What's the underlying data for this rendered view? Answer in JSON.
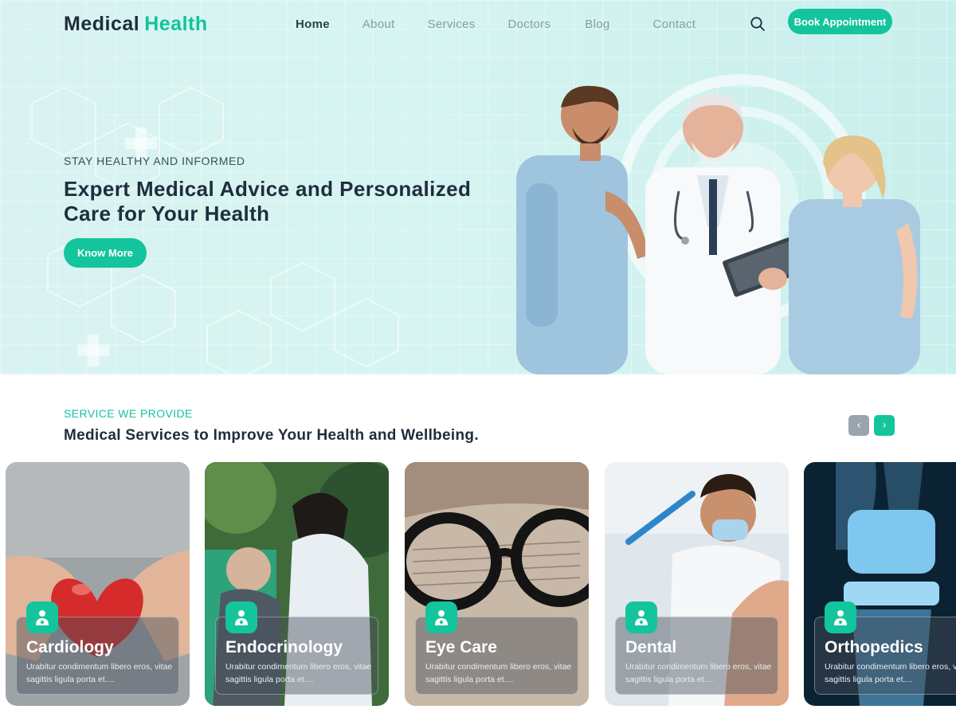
{
  "brand": {
    "word1": "Medical",
    "word2": "Health"
  },
  "nav": {
    "items": [
      {
        "label": "Home",
        "active": true
      },
      {
        "label": "About",
        "active": false
      },
      {
        "label": "Services",
        "active": false
      },
      {
        "label": "Doctors",
        "active": false
      },
      {
        "label": "Blog",
        "active": false
      },
      {
        "label": "Contact",
        "active": false
      }
    ],
    "search_icon": "search-icon",
    "cta": "Book Appointment"
  },
  "hero": {
    "eyebrow": "STAY HEALTHY AND INFORMED",
    "headline": "Expert Medical Advice and Personalized Care for Your Health",
    "button": "Know More"
  },
  "services": {
    "eyebrow": "SERVICE WE PROVIDE",
    "title": "Medical Services to Improve Your Health and Wellbeing.",
    "prev_icon": "chevron-left-icon",
    "next_icon": "chevron-right-icon",
    "cards": [
      {
        "name": "Cardiology",
        "desc": "Urabitur condimentum libero eros, vitae sagittis ligula porta et....",
        "icon": "doctor-icon"
      },
      {
        "name": "Endocrinology",
        "desc": "Urabitur condimentum libero eros, vitae sagittis ligula porta et....",
        "icon": "doctor-icon"
      },
      {
        "name": "Eye Care",
        "desc": "Urabitur condimentum libero eros, vitae sagittis ligula porta et....",
        "icon": "doctor-icon"
      },
      {
        "name": "Dental",
        "desc": "Urabitur condimentum libero eros, vitae sagittis ligula porta et....",
        "icon": "doctor-icon"
      },
      {
        "name": "Orthopedics",
        "desc": "Urabitur condimentum libero eros, vitae sagittis ligula porta et....",
        "icon": "doctor-icon"
      }
    ]
  },
  "colors": {
    "accent": "#14c49c",
    "heading": "#1f2d3d",
    "hero_bg": "#d6f4f1",
    "arrow_inactive": "#9aa4ad"
  }
}
